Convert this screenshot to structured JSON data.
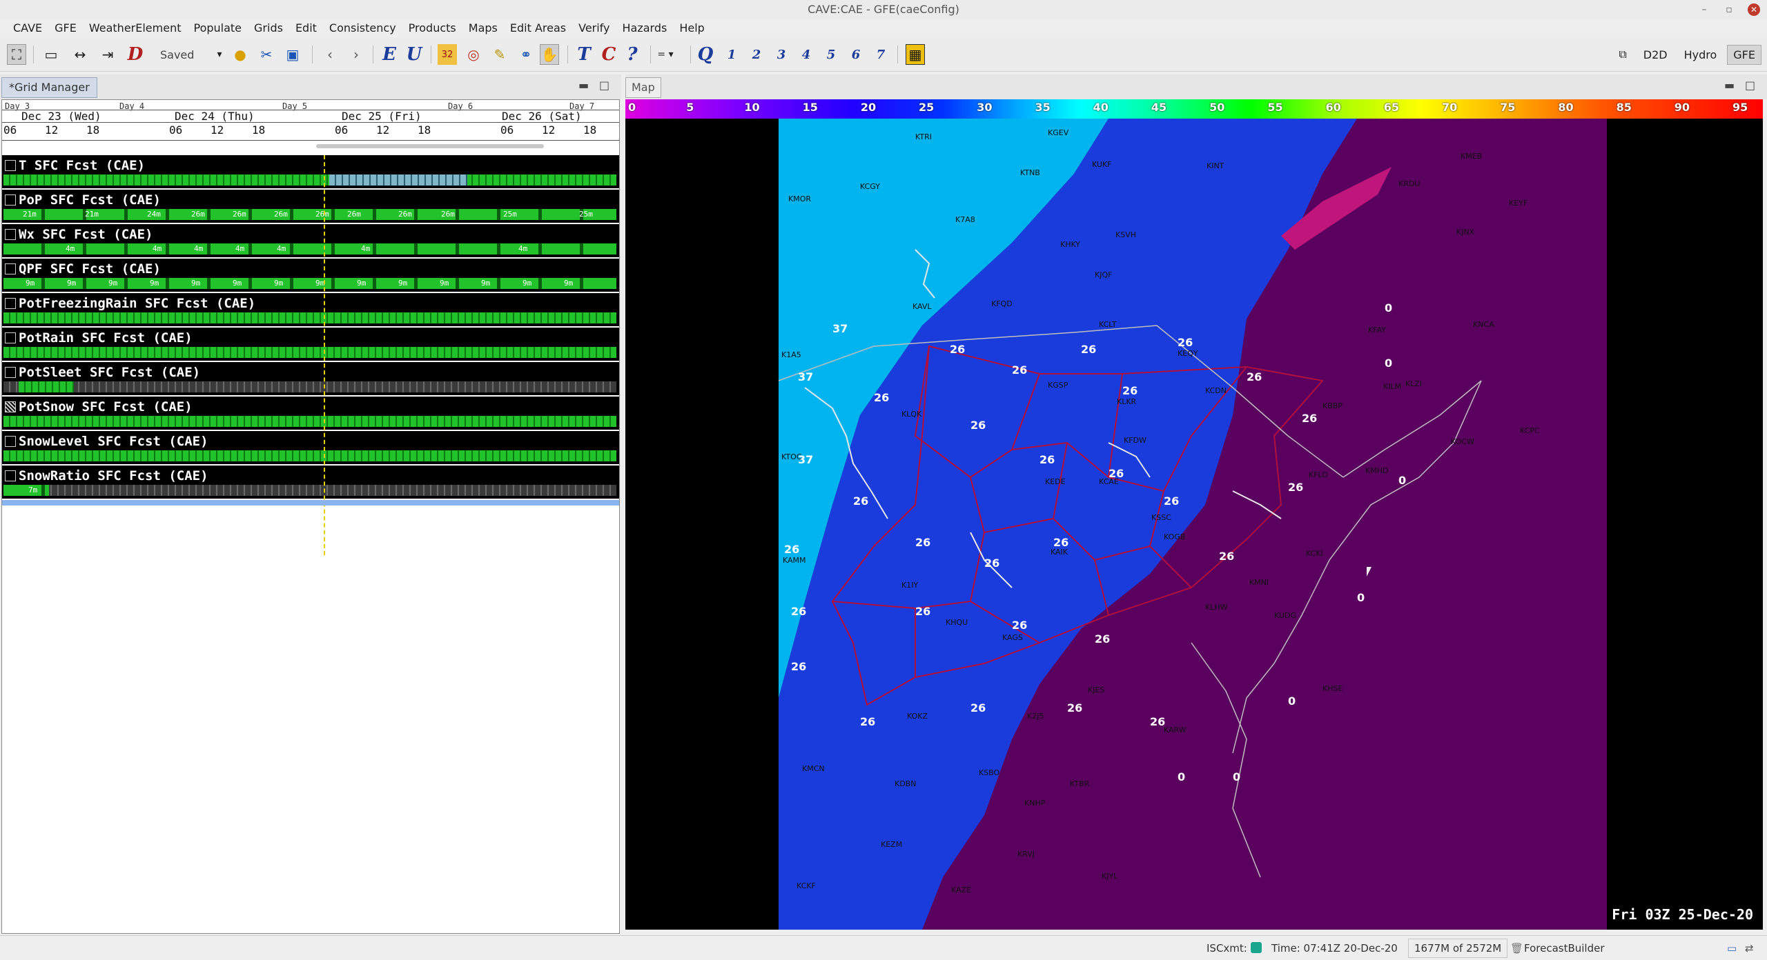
{
  "window": {
    "title": "CAVE:CAE - GFE(caeConfig)"
  },
  "menu": [
    "CAVE",
    "GFE",
    "WeatherElement",
    "Populate",
    "Grids",
    "Edit",
    "Consistency",
    "Products",
    "Maps",
    "Edit Areas",
    "Verify",
    "Hazards",
    "Help"
  ],
  "toolbar": {
    "saved_label": "Saved",
    "edit_letters": [
      "E",
      "U"
    ],
    "text_letters": [
      "T",
      "C",
      "?"
    ],
    "q_letter": "Q",
    "numbers": [
      "1",
      "2",
      "3",
      "4",
      "5",
      "6",
      "7"
    ],
    "d_letter": "D",
    "perspectives": [
      "D2D",
      "Hydro",
      "GFE"
    ],
    "active_perspective": "GFE"
  },
  "grid_manager": {
    "tab_label": "*Grid Manager",
    "days": [
      "Day 3",
      "Day 4",
      "Day 5",
      "Day 6",
      "Day 7"
    ],
    "dates": [
      "Dec 23 (Wed)",
      "Dec 24 (Thu)",
      "Dec 25 (Fri)",
      "Dec 26 (Sat)"
    ],
    "hours": [
      "06",
      "12",
      "18",
      "06",
      "12",
      "18",
      "06",
      "12",
      "18",
      "06",
      "12",
      "18"
    ],
    "rows": [
      {
        "label": "T SFC  Fcst (CAE)",
        "style": "blue"
      },
      {
        "label": "PoP SFC  Fcst (CAE)",
        "style": "sparse",
        "values": [
          "21m",
          "21m",
          "24m",
          "26m",
          "26m",
          "26m",
          "26m",
          "26m",
          "26m",
          "26m",
          "25m",
          "25m"
        ]
      },
      {
        "label": "Wx SFC  Fcst (CAE)",
        "style": "sparse",
        "values": [
          "4m",
          "4m",
          "4m",
          "4m",
          "4m",
          "4m",
          "4m"
        ]
      },
      {
        "label": "QPF SFC  Fcst (CAE)",
        "style": "sparse",
        "values": [
          "9m",
          "9m",
          "9m",
          "9m",
          "9m",
          "9m",
          "9m",
          "9m",
          "9m",
          "9m",
          "9m",
          "9m",
          "9m",
          "9m"
        ]
      },
      {
        "label": "PotFreezingRain SFC  Fcst (CAE)",
        "style": "dense"
      },
      {
        "label": "PotRain SFC  Fcst (CAE)",
        "style": "dense"
      },
      {
        "label": "PotSleet SFC  Fcst (CAE)",
        "style": "short"
      },
      {
        "label": "PotSnow SFC  Fcst (CAE)",
        "style": "dense"
      },
      {
        "label": "SnowLevel SFC  Fcst (CAE)",
        "style": "dense"
      },
      {
        "label": "SnowRatio SFC  Fcst (CAE)",
        "style": "short",
        "values": [
          "7m"
        ]
      }
    ]
  },
  "map": {
    "tab_label": "Map",
    "colorbar_ticks": [
      "0",
      "5",
      "10",
      "15",
      "20",
      "25",
      "30",
      "35",
      "40",
      "45",
      "50",
      "55",
      "60",
      "65",
      "70",
      "75",
      "80",
      "85",
      "90",
      "95"
    ],
    "valid_time": "Fri 03Z 25-Dec-20",
    "colors": {
      "light_blue": "#00b4f0",
      "blue": "#1a3cdc",
      "purple": "#5a005e",
      "county_lines": "#b01040",
      "no_data": "#000000"
    },
    "stations": [
      "KTRI",
      "KGEV",
      "KUKF",
      "KINT",
      "KCGY",
      "KTNB",
      "KMOR",
      "K7A8",
      "KHKY",
      "KSVH",
      "KJQF",
      "KAVL",
      "KFQD",
      "KCLT",
      "KEQY",
      "KLQK",
      "KGSP",
      "KLKR",
      "KCDN",
      "KFDW",
      "KEDE",
      "KOGB",
      "KAIK",
      "KCAE",
      "KSSC",
      "KCKI",
      "KMHD",
      "KFLO",
      "KAGS",
      "K2J5",
      "KLHW",
      "KARW",
      "KJES",
      "KOKZ",
      "KDBN",
      "KSBO",
      "KTBR",
      "KMCN",
      "KEZM",
      "KNHP",
      "KRVJ",
      "KJYL",
      "KCKF",
      "KAZE",
      "KMNI",
      "KUDG",
      "KBBP",
      "KHSE",
      "KILM",
      "KRDU",
      "KFAY",
      "KMEB",
      "KEYF",
      "KOCW",
      "KNCA",
      "KJNX",
      "KCPC",
      "K1A5",
      "KTOC",
      "KAMM",
      "K1IY",
      "KHQU",
      "KLZI"
    ],
    "value_labels": [
      "37",
      "26",
      "0"
    ]
  },
  "status": {
    "isc_label": "ISCxmt:",
    "time_label": "Time: 07:41Z 20-Dec-20",
    "memory_label": "1677M of 2572M",
    "app_label": "ForecastBuilder"
  }
}
